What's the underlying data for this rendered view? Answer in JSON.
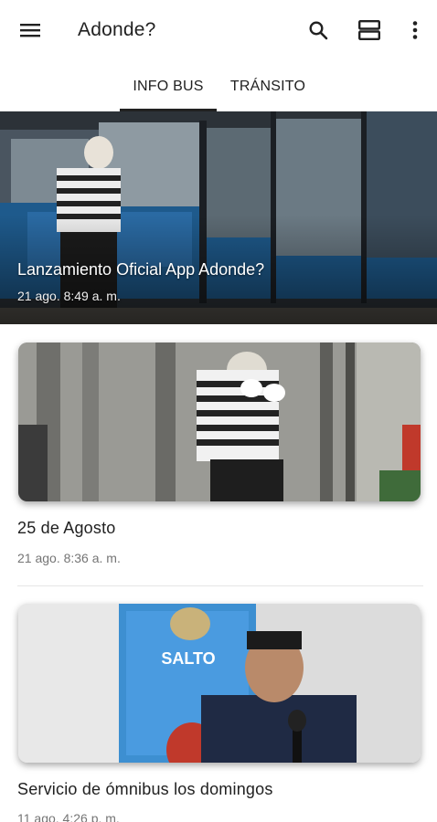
{
  "app_bar": {
    "title": "Adonde?",
    "menu_icon": "hamburger-menu-icon",
    "search_icon": "search-icon",
    "view_icon": "view-agenda-icon",
    "more_icon": "more-vert-icon"
  },
  "tabs": [
    {
      "label": "INFO BUS",
      "selected": true
    },
    {
      "label": "TRÁNSITO",
      "selected": false
    }
  ],
  "hero": {
    "title": "Lanzamiento Oficial App Adonde?",
    "date": "21 ago. 8:49 a. m."
  },
  "cards": [
    {
      "title": "25 de Agosto",
      "date": "21 ago. 8:36 a. m."
    },
    {
      "title": "Servicio de ómnibus los domingos",
      "date": "11 ago. 4:26 p. m."
    }
  ],
  "colors": {
    "bus_blue": "#1e5a8c",
    "indicator": "#212121",
    "date_gray": "#757575"
  }
}
